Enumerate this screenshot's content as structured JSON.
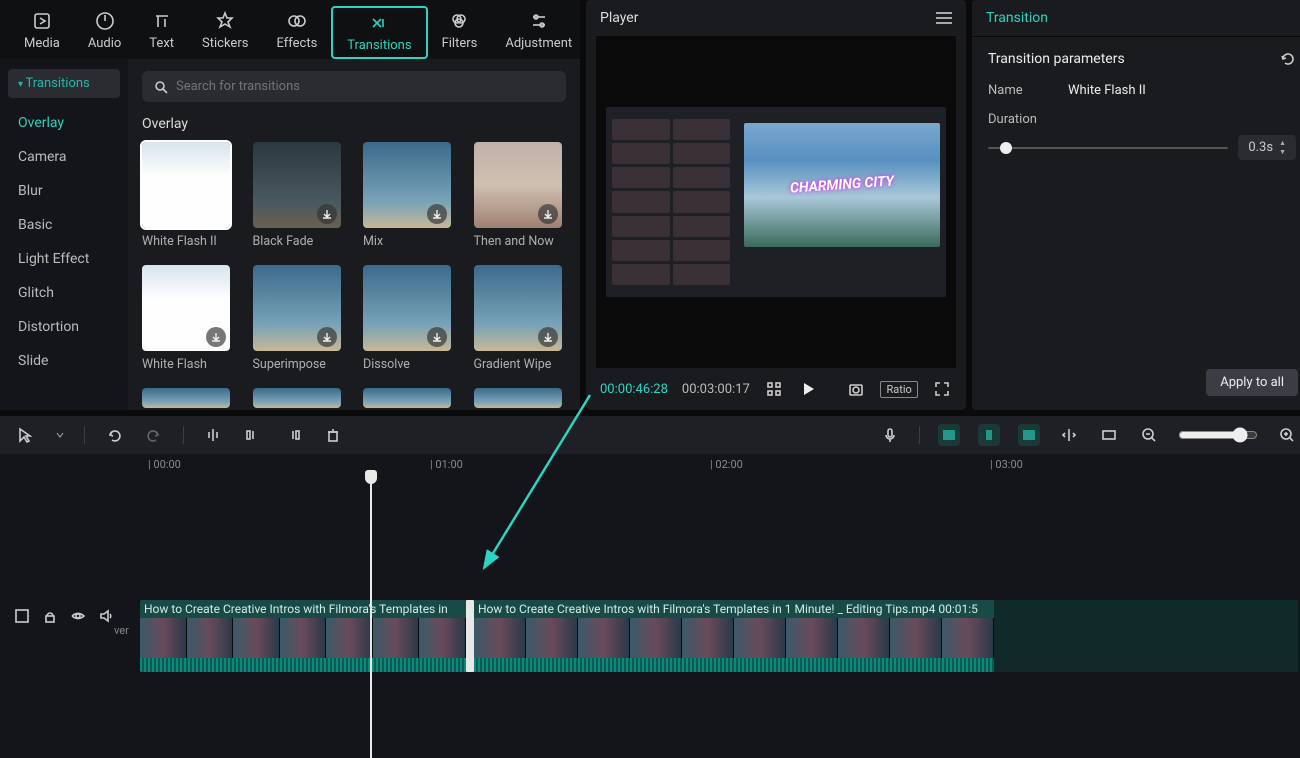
{
  "top_tabs": {
    "media": "Media",
    "audio": "Audio",
    "text": "Text",
    "stickers": "Stickers",
    "effects": "Effects",
    "transitions": "Transitions",
    "filters": "Filters",
    "adjustment": "Adjustment"
  },
  "sidebar": {
    "heading": "Transitions",
    "items": [
      "Overlay",
      "Camera",
      "Blur",
      "Basic",
      "Light Effect",
      "Glitch",
      "Distortion",
      "Slide"
    ]
  },
  "search": {
    "placeholder": "Search for transitions"
  },
  "section_title": "Overlay",
  "thumbs": [
    {
      "label": "White Flash II",
      "cls": "t-white",
      "selected": true,
      "dl": false
    },
    {
      "label": "Black Fade",
      "cls": "t-dark",
      "selected": false,
      "dl": true
    },
    {
      "label": "Mix",
      "cls": "",
      "selected": false,
      "dl": true
    },
    {
      "label": "Then and Now",
      "cls": "t-face",
      "selected": false,
      "dl": true
    },
    {
      "label": "White Flash",
      "cls": "t-white",
      "selected": false,
      "dl": true
    },
    {
      "label": "Superimpose",
      "cls": "",
      "selected": false,
      "dl": true
    },
    {
      "label": "Dissolve",
      "cls": "",
      "selected": false,
      "dl": true
    },
    {
      "label": "Gradient Wipe",
      "cls": "",
      "selected": false,
      "dl": true
    }
  ],
  "player": {
    "title": "Player",
    "preview_overlay": "CHARMING CITY",
    "tc_current": "00:00:46:28",
    "tc_total": "00:03:00:17",
    "ratio": "Ratio"
  },
  "inspector": {
    "title": "Transition",
    "section": "Transition parameters",
    "name_lbl": "Name",
    "name_val": "White Flash II",
    "duration_lbl": "Duration",
    "duration_val": "0.3s",
    "apply_all": "Apply to all"
  },
  "timeline": {
    "ticks": [
      "| 00:00",
      "| 01:00",
      "| 02:00",
      "| 03:00"
    ],
    "clip1_label": "How to Create Creative Intros with Filmora's Templates in",
    "clip2_label": "How to Create Creative Intros with Filmora's Templates in 1 Minute! _ Editing Tips.mp4   00:01:5",
    "track_ver": "ver"
  }
}
